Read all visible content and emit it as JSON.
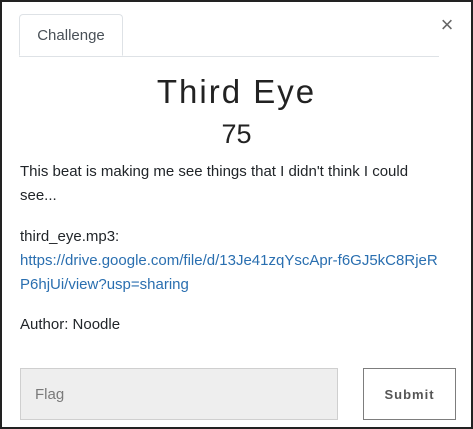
{
  "tabs": [
    {
      "label": "Challenge",
      "active": true
    }
  ],
  "close": {
    "symbol": "×"
  },
  "challenge": {
    "name": "Third Eye",
    "points": "75",
    "description": "This beat is making me see things that I didn't think I could see...",
    "file_label": "third_eye.mp3:",
    "file_url": "https://drive.google.com/file/d/13Je41zqYscApr-f6GJ5kC8RjeRP6hjUi/view?usp=sharing",
    "author": "Author: Noodle"
  },
  "form": {
    "flag_placeholder": "Flag",
    "flag_value": "",
    "submit_label": "Submit"
  },
  "colors": {
    "link": "#2a6fb0",
    "input_bg": "#eeeeee",
    "border": "#222222"
  }
}
